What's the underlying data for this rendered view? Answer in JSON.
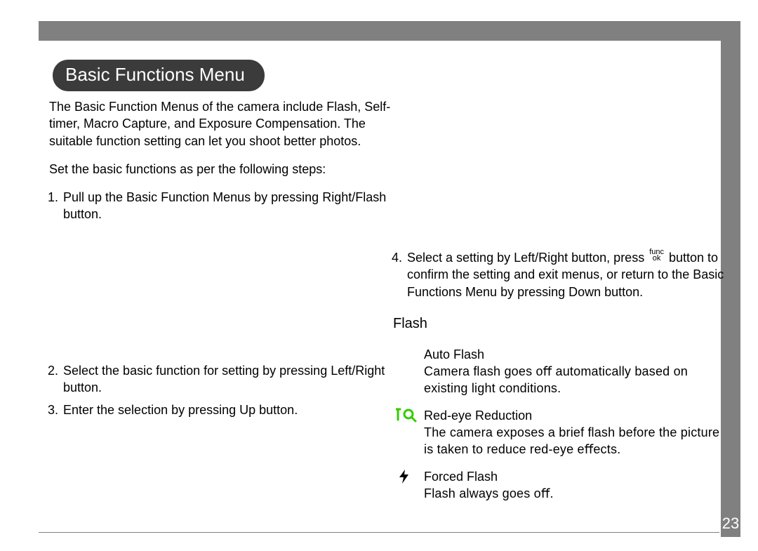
{
  "page_number": "23",
  "title": "Basic Functions Menu",
  "intro": {
    "p1": "The Basic Function Menus of the camera include Flash, Self-timer, Macro Capture, and Exposure Compensation. The suitable function setting can let you shoot better photos.",
    "p2": "Set the basic functions as per the following steps:"
  },
  "steps_left": {
    "s1": "Pull up the Basic Function Menus by pressing Right/Flash button.",
    "s2": "Select the basic function for setting by pressing Left/Right button.",
    "s3": "Enter the selection by pressing Up button."
  },
  "steps_right": {
    "s4_a": "Select a setting by Left/Right button, press ",
    "s4_func_top": "func",
    "s4_func_bot": "ok",
    "s4_b": " button to conﬁrm the setting and exit menus, or return to the Basic Functions Menu by pressing Down button."
  },
  "flash_section_title": "Flash",
  "flash": {
    "auto": {
      "name": "Auto Flash",
      "desc": "Camera ﬂash goes oﬀ automatically based on existing light conditions."
    },
    "redeye": {
      "name": "Red-eye Reduction",
      "desc": "The camera exposes a brief ﬂash before the picture is taken to reduce red-eye eﬀects."
    },
    "forced": {
      "name": "Forced Flash",
      "desc": "Flash always goes oﬀ."
    }
  }
}
